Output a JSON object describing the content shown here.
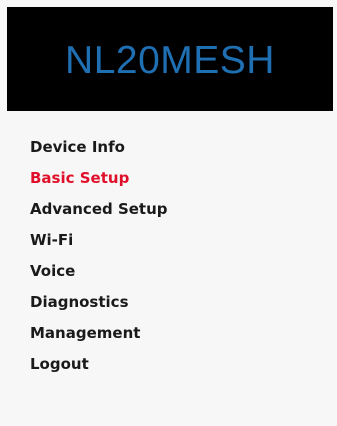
{
  "brand": {
    "title": "NL20MESH",
    "background_color": "#000000",
    "text_color": "#1f6fb3"
  },
  "nav": {
    "active_index": 1,
    "active_color": "#e0102b",
    "items": [
      {
        "label": "Device Info"
      },
      {
        "label": "Basic Setup"
      },
      {
        "label": "Advanced Setup"
      },
      {
        "label": "Wi-Fi"
      },
      {
        "label": "Voice"
      },
      {
        "label": "Diagnostics"
      },
      {
        "label": "Management"
      },
      {
        "label": "Logout"
      }
    ]
  }
}
